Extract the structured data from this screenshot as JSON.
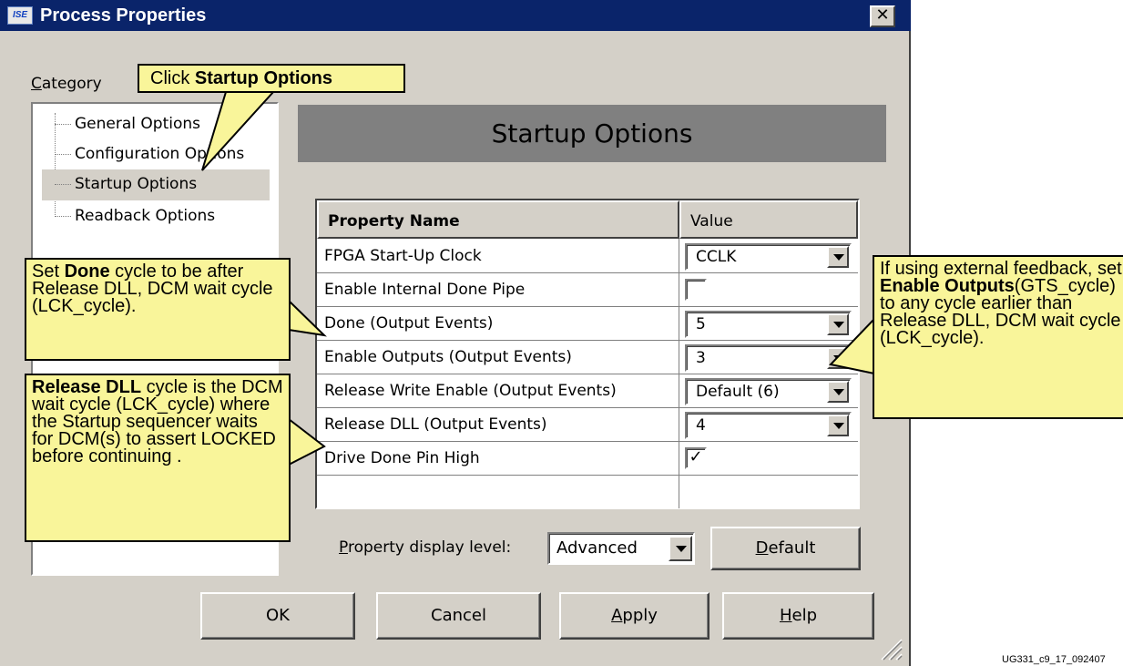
{
  "window": {
    "title": "Process Properties",
    "icon_label": "ISE",
    "close_label": "✕"
  },
  "category": {
    "label": "Category",
    "items": [
      {
        "label": "General Options"
      },
      {
        "label": "Configuration Options"
      },
      {
        "label": "Startup Options",
        "selected": true
      },
      {
        "label": "Readback Options"
      }
    ]
  },
  "section_header": "Startup Options",
  "table": {
    "col_property": "Property Name",
    "col_value": "Value",
    "rows": [
      {
        "name": "FPGA Start-Up Clock",
        "type": "dropdown",
        "value": "CCLK"
      },
      {
        "name": "Enable Internal Done Pipe",
        "type": "checkbox",
        "value": "",
        "checked": false
      },
      {
        "name": "Done (Output Events)",
        "type": "dropdown",
        "value": "5"
      },
      {
        "name": "Enable Outputs (Output Events)",
        "type": "dropdown",
        "value": "3"
      },
      {
        "name": "Release Write Enable (Output Events)",
        "type": "dropdown",
        "value": "Default (6)"
      },
      {
        "name": "Release DLL (Output Events)",
        "type": "dropdown",
        "value": "4"
      },
      {
        "name": "Drive Done Pin High",
        "type": "checkbox",
        "value": "✓",
        "checked": true
      }
    ]
  },
  "display_level": {
    "label_prefix": "P",
    "label_rest": "roperty display level:",
    "value": "Advanced"
  },
  "buttons": {
    "default_prefix": "D",
    "default_rest": "efault",
    "ok": "OK",
    "cancel": "Cancel",
    "apply_prefix": "A",
    "apply_rest": "pply",
    "help_prefix": "H",
    "help_rest": "elp"
  },
  "callouts": {
    "top_plain": "Click ",
    "top_bold": "Startup Options",
    "done_pre": "Set ",
    "done_bold": "Done",
    "done_post": " cycle to be after Release DLL, DCM wait cycle (LCK_cycle).",
    "dll_bold": "Release DLL",
    "dll_post": " cycle is the DCM wait cycle (LCK_cycle) where the Startup sequencer waits for DCM(s) to assert LOCKED before continuing .",
    "right_pre": "If using external feedback, set ",
    "right_bold": "Enable Outputs",
    "right_post": "(GTS_cycle) to any cycle earlier than Release DLL, DCM wait cycle (LCK_cycle)."
  },
  "figure_id": "UG331_c9_17_092407",
  "colors": {
    "title_bar": "#0a246a",
    "dialog_face": "#d4d0c8",
    "header_band": "#808080",
    "callout_fill": "#f9f59a"
  }
}
